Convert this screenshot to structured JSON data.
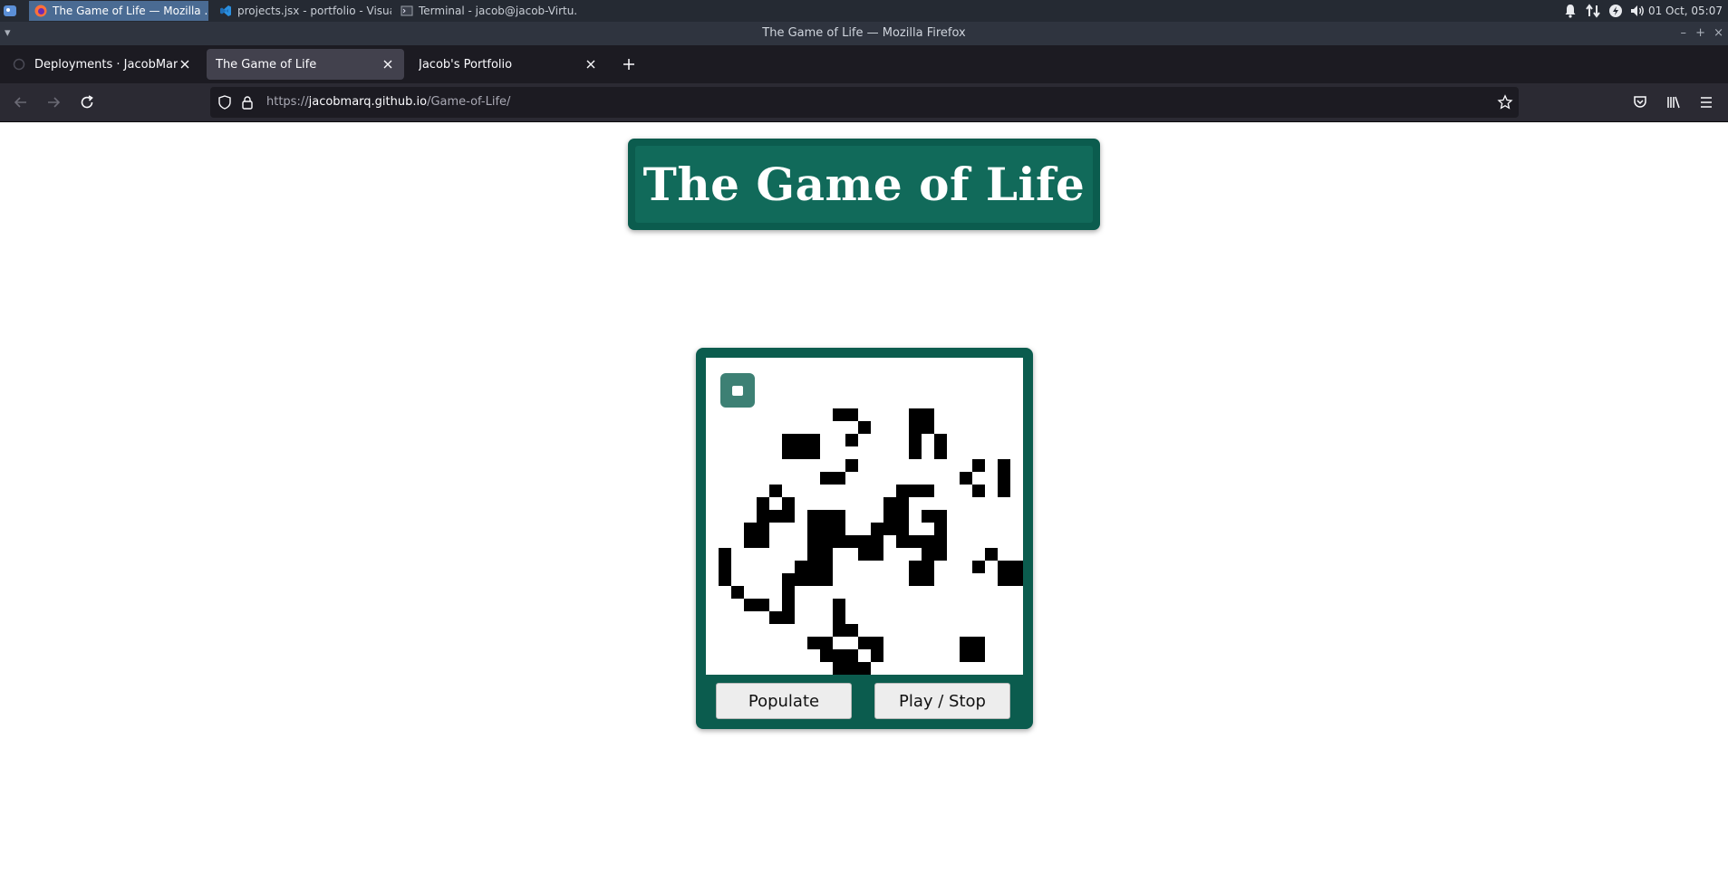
{
  "os_panel": {
    "tasks": [
      {
        "label": "The Game of Life — Mozilla ...",
        "icon": "firefox-icon",
        "active": true
      },
      {
        "label": "projects.jsx - portfolio - Visua...",
        "icon": "vscode-icon",
        "active": false
      },
      {
        "label": "Terminal - jacob@jacob-Virtu...",
        "icon": "terminal-icon",
        "active": false
      }
    ],
    "clock": "01 Oct, 05:07"
  },
  "window": {
    "title": "The Game of Life — Mozilla Firefox"
  },
  "tabs": [
    {
      "label": "Deployments · JacobMarq/Ro",
      "selected": false
    },
    {
      "label": "The Game of Life",
      "selected": true
    },
    {
      "label": "Jacob's Portfolio",
      "selected": false
    }
  ],
  "navbar": {
    "url_scheme": "https://",
    "url_host": "jacobmarq.github.io",
    "url_path": "/Game-of-Life/"
  },
  "page": {
    "title": "The Game of Life",
    "populate_label": "Populate",
    "play_stop_label": "Play / Stop"
  },
  "board": {
    "cols": 25,
    "rows": 25,
    "alive_color": "#000000",
    "dead_color": "#ffffff",
    "panel_color": "#0b5c4e",
    "live_cells": [
      [
        10,
        4
      ],
      [
        11,
        4
      ],
      [
        16,
        4
      ],
      [
        17,
        4
      ],
      [
        12,
        5
      ],
      [
        16,
        5
      ],
      [
        17,
        5
      ],
      [
        6,
        6
      ],
      [
        7,
        6
      ],
      [
        8,
        6
      ],
      [
        11,
        6
      ],
      [
        16,
        6
      ],
      [
        18,
        6
      ],
      [
        6,
        7
      ],
      [
        7,
        7
      ],
      [
        8,
        7
      ],
      [
        16,
        7
      ],
      [
        18,
        7
      ],
      [
        11,
        8
      ],
      [
        21,
        8
      ],
      [
        23,
        8
      ],
      [
        9,
        9
      ],
      [
        10,
        9
      ],
      [
        20,
        9
      ],
      [
        23,
        9
      ],
      [
        5,
        10
      ],
      [
        15,
        10
      ],
      [
        16,
        10
      ],
      [
        17,
        10
      ],
      [
        21,
        10
      ],
      [
        23,
        10
      ],
      [
        4,
        11
      ],
      [
        6,
        11
      ],
      [
        14,
        11
      ],
      [
        15,
        11
      ],
      [
        4,
        12
      ],
      [
        5,
        12
      ],
      [
        6,
        12
      ],
      [
        8,
        12
      ],
      [
        9,
        12
      ],
      [
        10,
        12
      ],
      [
        14,
        12
      ],
      [
        15,
        12
      ],
      [
        17,
        12
      ],
      [
        18,
        12
      ],
      [
        3,
        13
      ],
      [
        4,
        13
      ],
      [
        8,
        13
      ],
      [
        9,
        13
      ],
      [
        10,
        13
      ],
      [
        13,
        13
      ],
      [
        14,
        13
      ],
      [
        15,
        13
      ],
      [
        18,
        13
      ],
      [
        3,
        14
      ],
      [
        4,
        14
      ],
      [
        8,
        14
      ],
      [
        9,
        14
      ],
      [
        10,
        14
      ],
      [
        11,
        14
      ],
      [
        12,
        14
      ],
      [
        13,
        14
      ],
      [
        15,
        14
      ],
      [
        16,
        14
      ],
      [
        17,
        14
      ],
      [
        18,
        14
      ],
      [
        1,
        15
      ],
      [
        8,
        15
      ],
      [
        9,
        15
      ],
      [
        12,
        15
      ],
      [
        13,
        15
      ],
      [
        17,
        15
      ],
      [
        18,
        15
      ],
      [
        22,
        15
      ],
      [
        1,
        16
      ],
      [
        7,
        16
      ],
      [
        8,
        16
      ],
      [
        9,
        16
      ],
      [
        16,
        16
      ],
      [
        17,
        16
      ],
      [
        21,
        16
      ],
      [
        23,
        16
      ],
      [
        24,
        16
      ],
      [
        1,
        17
      ],
      [
        6,
        17
      ],
      [
        7,
        17
      ],
      [
        8,
        17
      ],
      [
        9,
        17
      ],
      [
        16,
        17
      ],
      [
        17,
        17
      ],
      [
        23,
        17
      ],
      [
        24,
        17
      ],
      [
        2,
        18
      ],
      [
        6,
        18
      ],
      [
        3,
        19
      ],
      [
        4,
        19
      ],
      [
        6,
        19
      ],
      [
        10,
        19
      ],
      [
        5,
        20
      ],
      [
        6,
        20
      ],
      [
        10,
        20
      ],
      [
        10,
        21
      ],
      [
        11,
        21
      ],
      [
        8,
        22
      ],
      [
        9,
        22
      ],
      [
        12,
        22
      ],
      [
        13,
        22
      ],
      [
        20,
        22
      ],
      [
        21,
        22
      ],
      [
        9,
        23
      ],
      [
        10,
        23
      ],
      [
        11,
        23
      ],
      [
        13,
        23
      ],
      [
        20,
        23
      ],
      [
        21,
        23
      ],
      [
        10,
        24
      ],
      [
        11,
        24
      ],
      [
        12,
        24
      ]
    ]
  }
}
